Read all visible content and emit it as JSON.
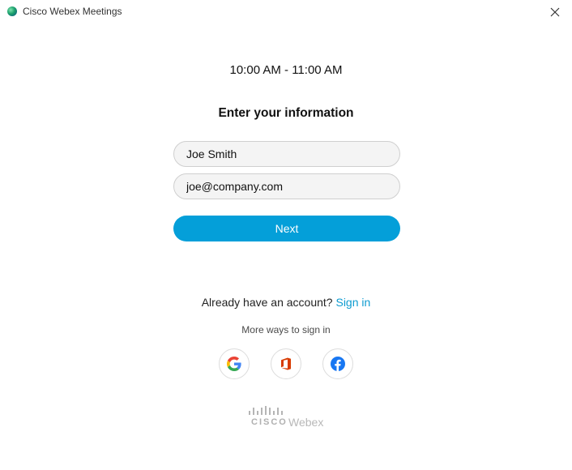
{
  "window": {
    "title": "Cisco Webex Meetings",
    "close_icon": "close-icon"
  },
  "meeting": {
    "time_range": "10:00 AM - 11:00 AM"
  },
  "form": {
    "heading": "Enter your information",
    "name_value": "Joe Smith",
    "email_value": "joe@company.com",
    "next_label": "Next"
  },
  "account": {
    "prompt": "Already have an account?",
    "sign_in_label": "Sign in",
    "more_ways": "More ways to sign in"
  },
  "social": [
    {
      "name": "google-icon"
    },
    {
      "name": "office-icon"
    },
    {
      "name": "facebook-icon"
    }
  ],
  "brand": {
    "cisco": "CISCO",
    "webex": "Webex"
  },
  "colors": {
    "accent": "#049fd9",
    "link": "#0d9bd0",
    "google_blue": "#4285F4",
    "google_red": "#EA4335",
    "google_yellow": "#FBBC05",
    "google_green": "#34A853",
    "office_orange": "#D83B01",
    "facebook_blue": "#1877F2"
  }
}
